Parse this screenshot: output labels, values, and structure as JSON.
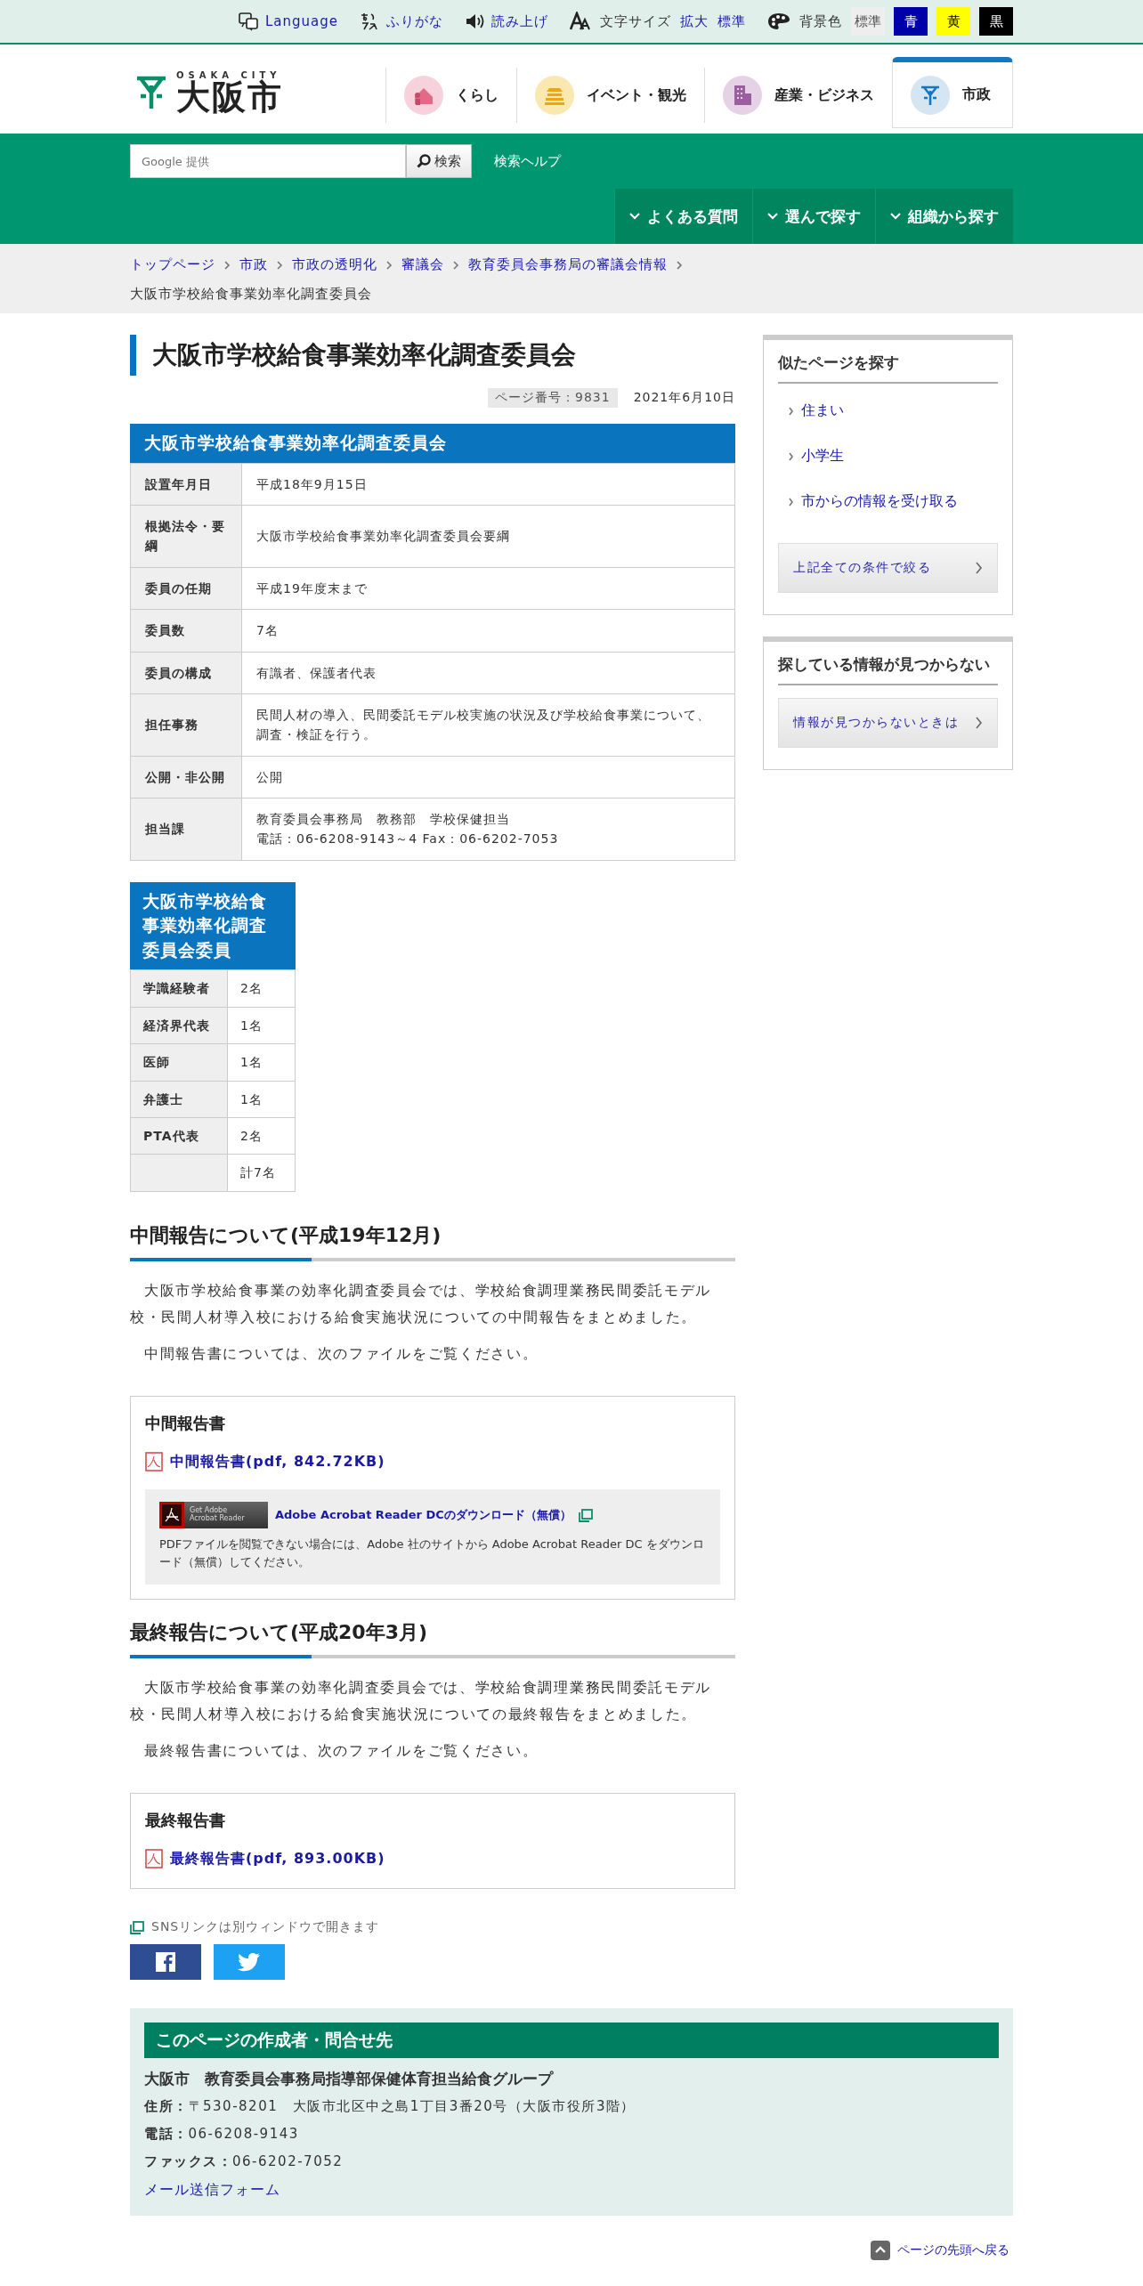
{
  "utility_bar": {
    "items": [
      {
        "kind": "language",
        "label": "Language"
      },
      {
        "kind": "furigana",
        "label": "ふりがな"
      },
      {
        "kind": "speech",
        "label": "読み上げ"
      }
    ],
    "font_size": {
      "label": "文字サイズ",
      "options": [
        "拡大",
        "標準"
      ]
    },
    "background": {
      "label": "背景色",
      "options": [
        {
          "label": "標準",
          "color": "#eeeeee"
        },
        {
          "label": "青",
          "color": "#0000aa"
        },
        {
          "label": "黄",
          "color": "#ffff00"
        },
        {
          "label": "黒",
          "color": "#000000"
        }
      ]
    }
  },
  "logo": {
    "subtitle": "OSAKA CITY",
    "name": "大阪市"
  },
  "nav_tabs": [
    {
      "kind": "home",
      "label": "くらし",
      "selected": false
    },
    {
      "kind": "castle",
      "label": "イベント・観光",
      "selected": false
    },
    {
      "kind": "building",
      "label": "産業・ビジネス",
      "selected": false
    },
    {
      "kind": "emblem",
      "label": "市政",
      "selected": true
    }
  ],
  "search": {
    "placeholder": "Google 提供",
    "button": "検索",
    "help": "検索ヘルプ"
  },
  "menu_buttons": [
    "よくある質問",
    "選んで探す",
    "組織から探す"
  ],
  "breadcrumb": {
    "links": [
      "トップページ",
      "市政",
      "市政の透明化",
      "審議会",
      "教育委員会事務局の審議会情報"
    ],
    "current": "大阪市学校給食事業効率化調査委員会"
  },
  "title": "大阪市学校給食事業効率化調査委員会",
  "page_number": "ページ番号：9831",
  "date": "2021年6月10日",
  "info_table": {
    "caption": "大阪市学校給食事業効率化調査委員会",
    "rows": [
      {
        "label": "設置年月日",
        "value": "平成18年9月15日"
      },
      {
        "label": "根拠法令・要綱",
        "value": "大阪市学校給食事業効率化調査委員会要綱"
      },
      {
        "label": "委員の任期",
        "value": "平成19年度末まで"
      },
      {
        "label": "委員数",
        "value": "7名"
      },
      {
        "label": "委員の構成",
        "value": "有識者、保護者代表"
      },
      {
        "label": "担任事務",
        "value": "民間人材の導入、民間委託モデル校実施の状況及び学校給食事業について、調査・検証を行う。"
      },
      {
        "label": "公開・非公開",
        "value": "公開"
      },
      {
        "label": "担当課",
        "lines": [
          "教育委員会事務局　教務部　学校保健担当",
          "電話：06-6208-9143～4 Fax：06-6202-7053"
        ]
      }
    ]
  },
  "members_table": {
    "caption": "大阪市学校給食事業効率化調査委員会委員",
    "rows": [
      {
        "label": "学識経験者",
        "value": "2名"
      },
      {
        "label": "経済界代表",
        "value": "1名"
      },
      {
        "label": "医師",
        "value": "1名"
      },
      {
        "label": "弁護士",
        "value": "1名"
      },
      {
        "label": "PTA代表",
        "value": "2名"
      },
      {
        "value": "計7名"
      }
    ]
  },
  "sections": [
    {
      "heading": "中間報告について(平成19年12月)",
      "paragraphs": [
        "大阪市学校給食事業の効率化調査委員会では、学校給食調理業務民間委託モデル校・民間人材導入校における給食実施状況についての中間報告をまとめました。",
        "中間報告書については、次のファイルをご覧ください。"
      ],
      "box": {
        "title": "中間報告書",
        "file": "中間報告書(pdf, 842.72KB)",
        "adobe": {
          "badge_top": "Get Adobe",
          "badge_bottom": "Acrobat Reader",
          "link": "Adobe Acrobat Reader DCのダウンロード（無償）",
          "note": "PDFファイルを閲覧できない場合には、Adobe 社のサイトから Adobe Acrobat Reader DC をダウンロード（無償）してください。"
        }
      }
    },
    {
      "heading": "最終報告について(平成20年3月)",
      "paragraphs": [
        "大阪市学校給食事業の効率化調査委員会では、学校給食調理業務民間委託モデル校・民間人材導入校における給食実施状況についての最終報告をまとめました。",
        "最終報告書については、次のファイルをご覧ください。"
      ],
      "box": {
        "title": "最終報告書",
        "file": "最終報告書(pdf, 893.00KB)"
      }
    }
  ],
  "sns": {
    "note": "SNSリンクは別ウィンドウで開きます",
    "buttons": [
      {
        "kind": "facebook"
      },
      {
        "kind": "twitter"
      }
    ]
  },
  "contact": {
    "heading": "このページの作成者・問合せ先",
    "organization": "大阪市　教育委員会事務局指導部保健体育担当給食グループ",
    "rows": [
      {
        "label": "住所：",
        "value": "〒530-8201　大阪市北区中之島1丁目3番20号（大阪市役所3階）"
      },
      {
        "label": "電話：",
        "value": "06-6208-9143"
      },
      {
        "label": "ファックス：",
        "value": "06-6202-7052"
      }
    ],
    "mail_link": "メール送信フォーム"
  },
  "sidebar": [
    {
      "title": "似たページを探す",
      "links": [
        "住まい",
        "小学生",
        "市からの情報を受け取る"
      ],
      "button": "上記全ての条件で絞る"
    },
    {
      "title": "探している情報が見つからない",
      "button": "情報が見つからないときは"
    }
  ],
  "page_top": "ページの先頭へ戻る"
}
